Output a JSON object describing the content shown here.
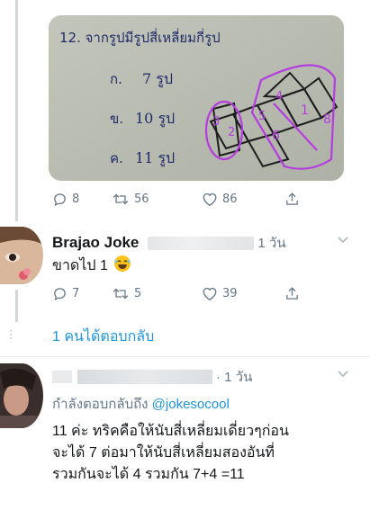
{
  "tweet": {
    "image_text": {
      "question": "12. จากรูปมีรูปสี่เหลี่ยมกี่รูป",
      "choices": [
        {
          "letter": "ก.",
          "text": "7 รูป"
        },
        {
          "letter": "ข.",
          "text": "10 รูป"
        },
        {
          "letter": "ค.",
          "text": "11 รูป"
        }
      ],
      "marks": [
        "3",
        "2",
        "4",
        "5",
        "1",
        "6",
        "8"
      ]
    },
    "actions": {
      "replies": "8",
      "retweets": "56",
      "likes": "86"
    }
  },
  "reply1": {
    "name": "Brajao Joke",
    "time": "1 วัน",
    "text": "ขาดไป 1",
    "actions": {
      "replies": "7",
      "retweets": "5",
      "likes": "39"
    },
    "more_replies": "1 คนได้ตอบกลับ"
  },
  "reply2": {
    "time": "· 1 วัน",
    "replying_to_label": "กำลังตอบกลับถึง",
    "replying_to_handle": "@jokesocool",
    "text_lines": [
      "11 ค่ะ ทริคคือให้นับสี่เหลี่ยมเดี่ยวๆก่อน",
      "จะได้ 7 ต่อมาให้นับสี่เหลี่ยมสองอันที่",
      "รวมกันจะได้ 4 รวมกัน 7+4 =11"
    ]
  },
  "colors": {
    "accent": "#1b95e0",
    "muted": "#657786",
    "annotation": "#b53ce0"
  },
  "icons": [
    "reply-icon",
    "retweet-icon",
    "like-icon",
    "share-icon",
    "chevron-down-icon",
    "laughing-emoji-icon"
  ]
}
